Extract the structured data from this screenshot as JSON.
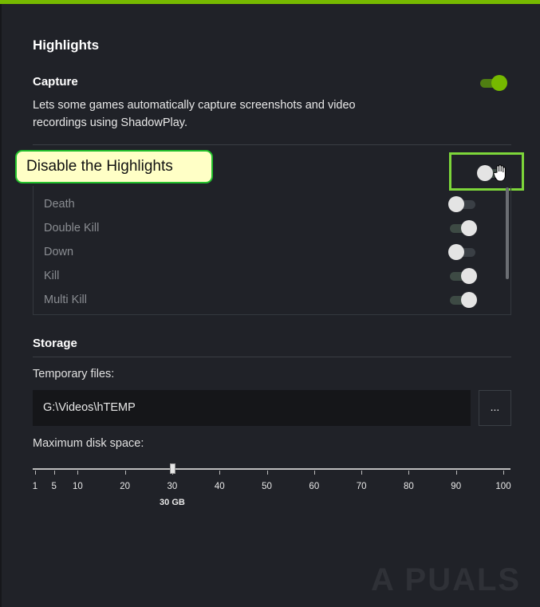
{
  "highlights": {
    "title": "Highlights",
    "capture": {
      "title": "Capture",
      "description": "Lets some games automatically capture screenshots and video recordings using ShadowPlay.",
      "enabled": true
    },
    "callout": "Disable the Highlights",
    "events": [
      {
        "label": "Death",
        "enabled": false
      },
      {
        "label": "Double Kill",
        "enabled": true
      },
      {
        "label": "Down",
        "enabled": false
      },
      {
        "label": "Kill",
        "enabled": true
      },
      {
        "label": "Multi Kill",
        "enabled": true
      }
    ]
  },
  "storage": {
    "title": "Storage",
    "temp_label": "Temporary files:",
    "temp_path": "G:\\Videos\\hTEMP",
    "browse_label": "...",
    "disk_label": "Maximum disk space:",
    "ticks": [
      "1",
      "5",
      "10",
      "20",
      "30",
      "40",
      "50",
      "60",
      "70",
      "80",
      "90",
      "100"
    ],
    "value": 30,
    "value_label": "30 GB"
  },
  "watermark": "A PUALS",
  "colors": {
    "accent": "#76b900",
    "callout_border": "#22c02c",
    "callout_bg": "#ffffc6"
  }
}
